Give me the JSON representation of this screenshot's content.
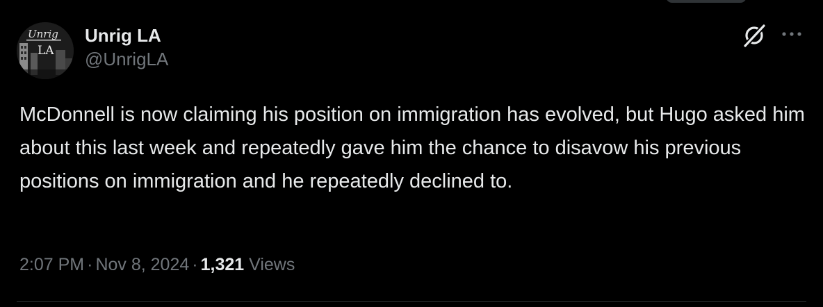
{
  "author": {
    "display_name": "Unrig LA",
    "handle": "@UnrigLA",
    "avatar_logo_text": "Unrig",
    "avatar_logo_sub": "LA"
  },
  "tweet": {
    "text": "McDonnell is now claiming his position on immigration has evolved, but Hugo asked him about this last week and repeatedly gave him the chance to disavow his previous positions on immigration and he repeatedly declined to."
  },
  "meta": {
    "time": "2:07 PM",
    "separator": "·",
    "date": "Nov 8, 2024",
    "views_count": "1,321",
    "views_label": "Views"
  },
  "icons": {
    "grok": "grok-icon",
    "more": "more-horizontal-icon"
  },
  "colors": {
    "background": "#000000",
    "primary_text": "#e7e9ea",
    "secondary_text": "#71767b",
    "divider": "#2f3336"
  }
}
